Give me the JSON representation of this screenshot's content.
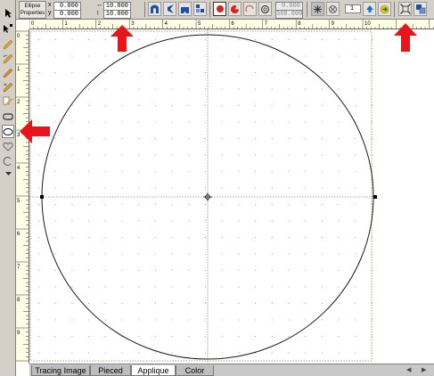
{
  "properties": {
    "title_line1": "Ellipse",
    "title_line2": "Properties",
    "x_label": "x",
    "y_label": "y",
    "x_value": "0.000",
    "y_value": "0.000",
    "width_value": "10.000",
    "height_value": "10.000",
    "angle_start": "0.000",
    "angle_end": "360.000",
    "count_value": "1"
  },
  "ruler": {
    "h_labels": [
      "0",
      "1",
      "2",
      "3",
      "4",
      "5",
      "6",
      "7",
      "8",
      "9",
      "10"
    ],
    "v_labels": [
      "0",
      "1",
      "2",
      "3",
      "4",
      "5",
      "6",
      "7",
      "8",
      "9",
      "10"
    ]
  },
  "tabs": [
    {
      "label": "Tracing Image"
    },
    {
      "label": "Pieced"
    },
    {
      "label": "Applique"
    },
    {
      "label": "Color"
    }
  ],
  "active_tab": "Applique",
  "colors": {
    "highlight_arrow": "#e8141c",
    "ui_face": "#d4d0c8",
    "ruler_bg": "#ffffe8",
    "guide_line": "#8c8a4a"
  }
}
